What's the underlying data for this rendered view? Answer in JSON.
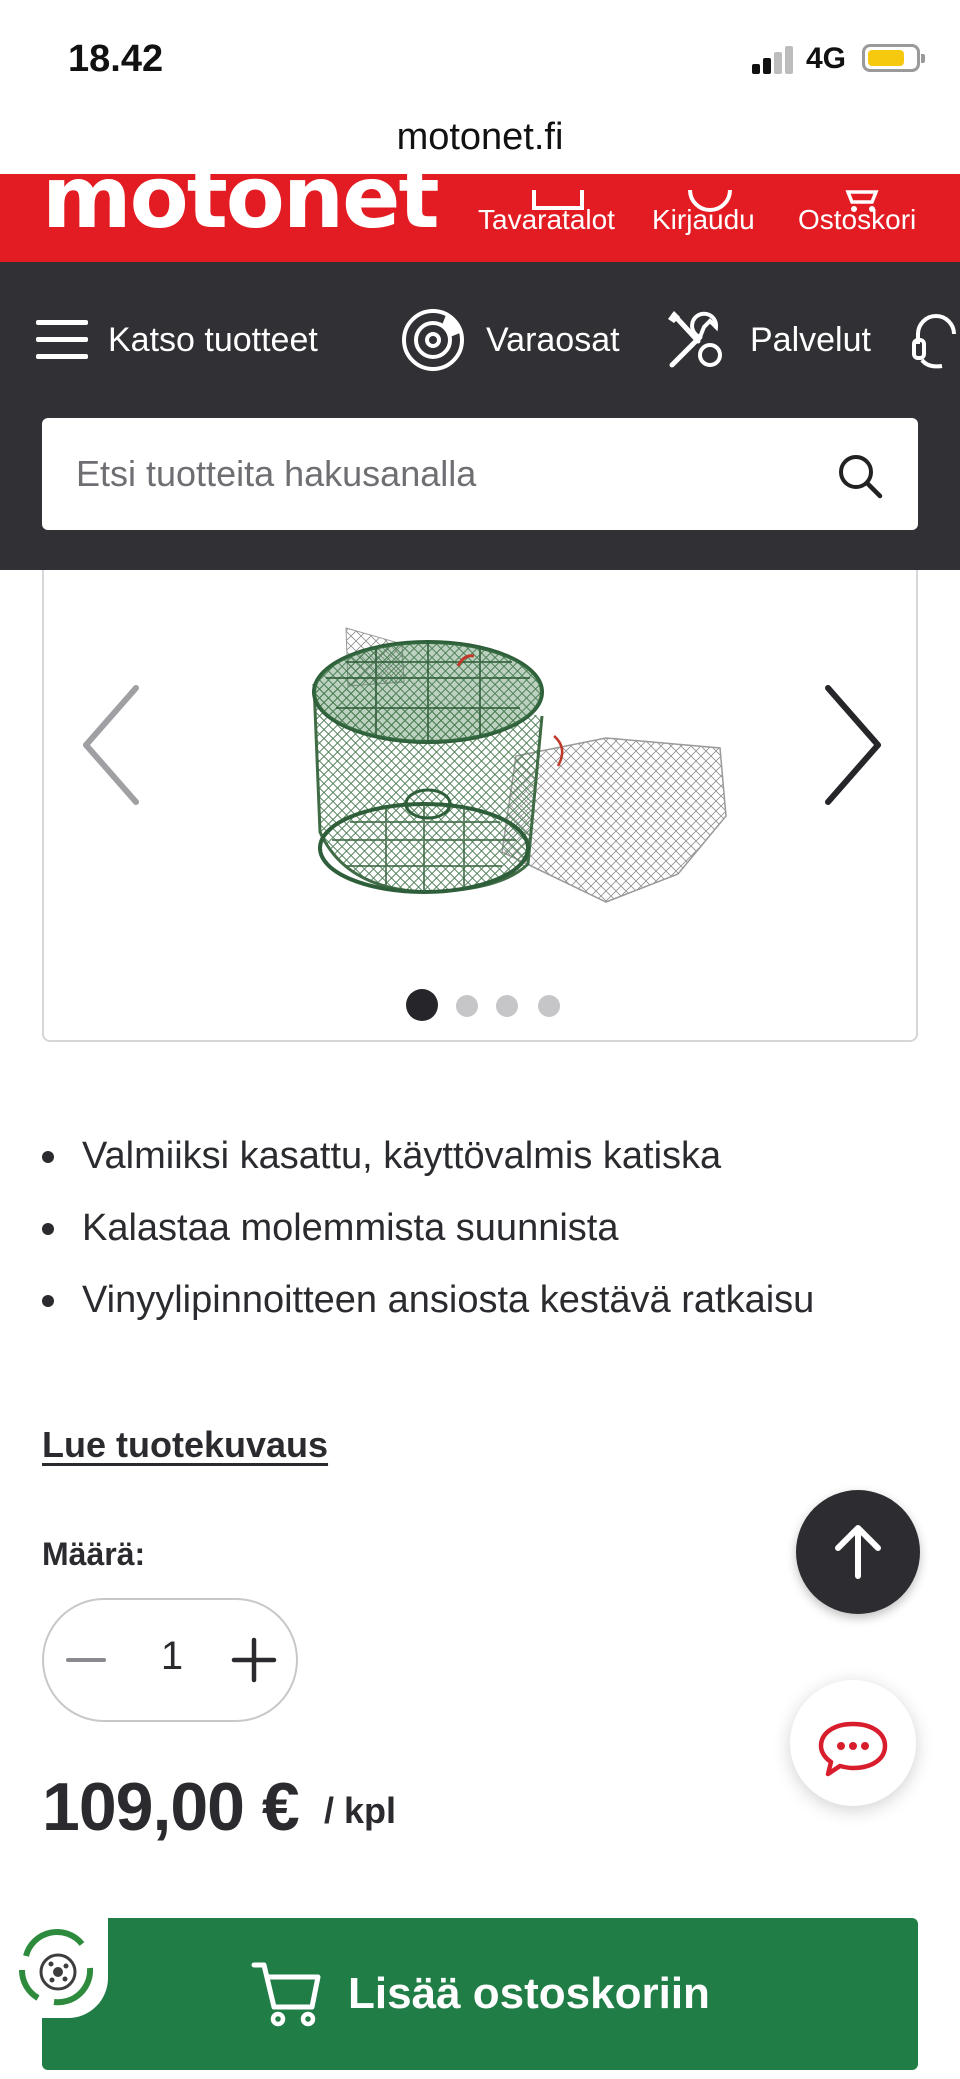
{
  "status_bar": {
    "time": "18.42",
    "network": "4G"
  },
  "browser": {
    "url": "motonet.fi"
  },
  "header": {
    "logo": "motonet",
    "stores_label": "Tavaratalot",
    "login_label": "Kirjaudu",
    "cart_label": "Ostoskori"
  },
  "nav": {
    "browse_label": "Katso tuotteet",
    "parts_label": "Varaosat",
    "services_label": "Palvelut"
  },
  "search": {
    "placeholder": "Etsi tuotteita hakusanalla",
    "value": ""
  },
  "carousel": {
    "image_count": 4,
    "active_index": 0
  },
  "product": {
    "features": [
      "Valmiiksi kasattu, käyttövalmis katiska",
      "Kalastaa molemmista suunnista",
      "Vinyylipinnoitteen ansiosta kestävä ratkaisu"
    ],
    "read_description_label": "Lue tuotekuvaus",
    "quantity_label": "Määrä:",
    "quantity_value": "1",
    "price": "109,00 €",
    "unit": "/ kpl",
    "add_to_cart_label": "Lisää ostoskoriin"
  },
  "colors": {
    "brand_red": "#e31c23",
    "nav_dark": "#303035",
    "cart_green": "#1f7d45",
    "chat_red": "#d81e2c"
  }
}
